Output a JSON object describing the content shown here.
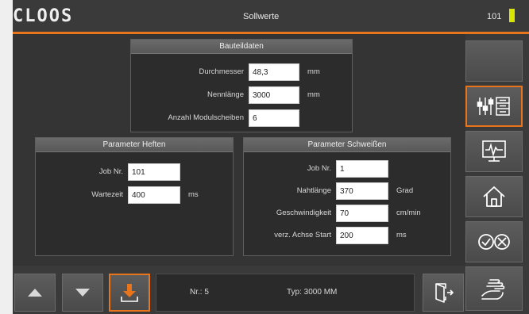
{
  "header": {
    "logo": "CLOOS",
    "title": "Sollwerte",
    "counter": "101",
    "status_color": "#d6e600",
    "accent_color": "#e8741b"
  },
  "bauteildaten": {
    "title": "Bauteildaten",
    "rows": [
      {
        "label": "Durchmesser",
        "value": "48,3",
        "unit": "mm"
      },
      {
        "label": "Nennlänge",
        "value": "3000",
        "unit": "mm"
      },
      {
        "label": "Anzahl Modulscheiben",
        "value": "6",
        "unit": ""
      }
    ]
  },
  "heften": {
    "title": "Parameter Heften",
    "rows": [
      {
        "label": "Job Nr.",
        "value": "101",
        "unit": ""
      },
      {
        "label": "Wartezeit",
        "value": "400",
        "unit": "ms"
      }
    ]
  },
  "schweissen": {
    "title": "Parameter Schweißen",
    "rows": [
      {
        "label": "Job Nr.",
        "value": "1",
        "unit": ""
      },
      {
        "label": "Nahtlänge",
        "value": "370",
        "unit": "Grad"
      },
      {
        "label": "Geschwindigkeit",
        "value": "70",
        "unit": "cm/min"
      },
      {
        "label": "verz. Achse Start",
        "value": "200",
        "unit": "ms"
      }
    ]
  },
  "bottom": {
    "nr": "Nr.: 5",
    "typ": "Typ: 3000 MM"
  },
  "sidebar": {
    "buttons": [
      {
        "icon": "blank-icon"
      },
      {
        "icon": "parameters-icon",
        "active": true
      },
      {
        "icon": "monitor-waveform-icon"
      },
      {
        "icon": "home-icon"
      },
      {
        "icon": "confirm-cancel-icon"
      },
      {
        "icon": "hand-icon"
      }
    ]
  }
}
